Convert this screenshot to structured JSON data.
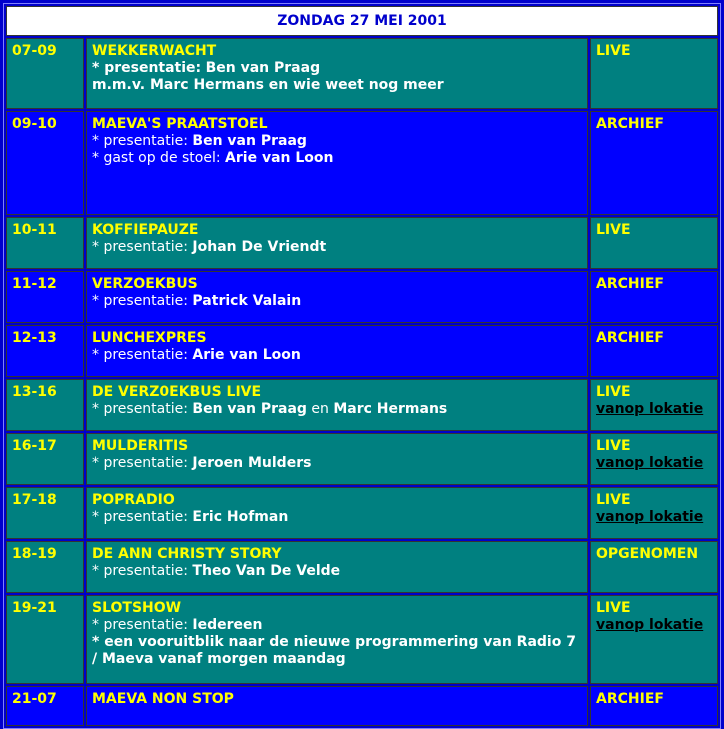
{
  "header": "ZONDAG 27 MEI 2001",
  "rows": [
    {
      "time": "07-09",
      "title": "WEKKERWACHT",
      "l1_label": "* presentatie:",
      "l1_name": "Ben van Praag",
      "l2": "m.m.v. Marc Hermans en wie weet nog meer",
      "status": "LIVE"
    },
    {
      "time": "09-10",
      "title": "MAEVA'S PRAATSTOEL",
      "l1_label": "* presentatie:",
      "l1_name": "Ben van Praag",
      "l2_label": "* gast op de stoel:",
      "l2_name": "Arie van Loon",
      "status": "ARCHIEF"
    },
    {
      "time": "10-11",
      "title": "KOFFIEPAUZE",
      "l1_label": "* presentatie:",
      "l1_name": "Johan De Vriendt",
      "status": "LIVE"
    },
    {
      "time": "11-12",
      "title": "VERZOEKBUS",
      "l1_label": "* presentatie:",
      "l1_name": "Patrick Valain",
      "status": "ARCHIEF"
    },
    {
      "time": "12-13",
      "title": "LUNCHEXPRES",
      "l1_label": "* presentatie:",
      "l1_name": "Arie van Loon",
      "status": "ARCHIEF"
    },
    {
      "time": "13-16",
      "title": "DE VERZ0EKBUS LIVE",
      "l1_label": "* presentatie:",
      "l1_name": "Ben van Praag",
      "l1_join": "en",
      "l1_name2": "Marc Hermans",
      "status": "LIVE",
      "link": "vanop lokatie"
    },
    {
      "time": "16-17",
      "title": "MULDERITIS",
      "l1_label": "* presentatie:",
      "l1_name": "Jeroen Mulders",
      "status": "LIVE",
      "link": "vanop lokatie"
    },
    {
      "time": "17-18",
      "title": "POPRADIO",
      "l1_label": "* presentatie:",
      "l1_name": "Eric Hofman",
      "status": "LIVE",
      "link": "vanop lokatie"
    },
    {
      "time": "18-19",
      "title": "DE ANN CHRISTY STORY",
      "l1_label": "* presentatie:",
      "l1_name": "Theo Van De Velde",
      "status": "OPGENOMEN"
    },
    {
      "time": "19-21",
      "title": "SLOTSHOW",
      "l1_label": "* presentatie:",
      "l1_name": "Iedereen",
      "l2": "* een vooruitblik naar de nieuwe programmering van Radio 7 / Maeva vanaf morgen maandag",
      "status": "LIVE",
      "link": "vanop lokatie"
    },
    {
      "time": "21-07",
      "title": "MAEVA NON STOP",
      "status": "ARCHIEF"
    }
  ]
}
